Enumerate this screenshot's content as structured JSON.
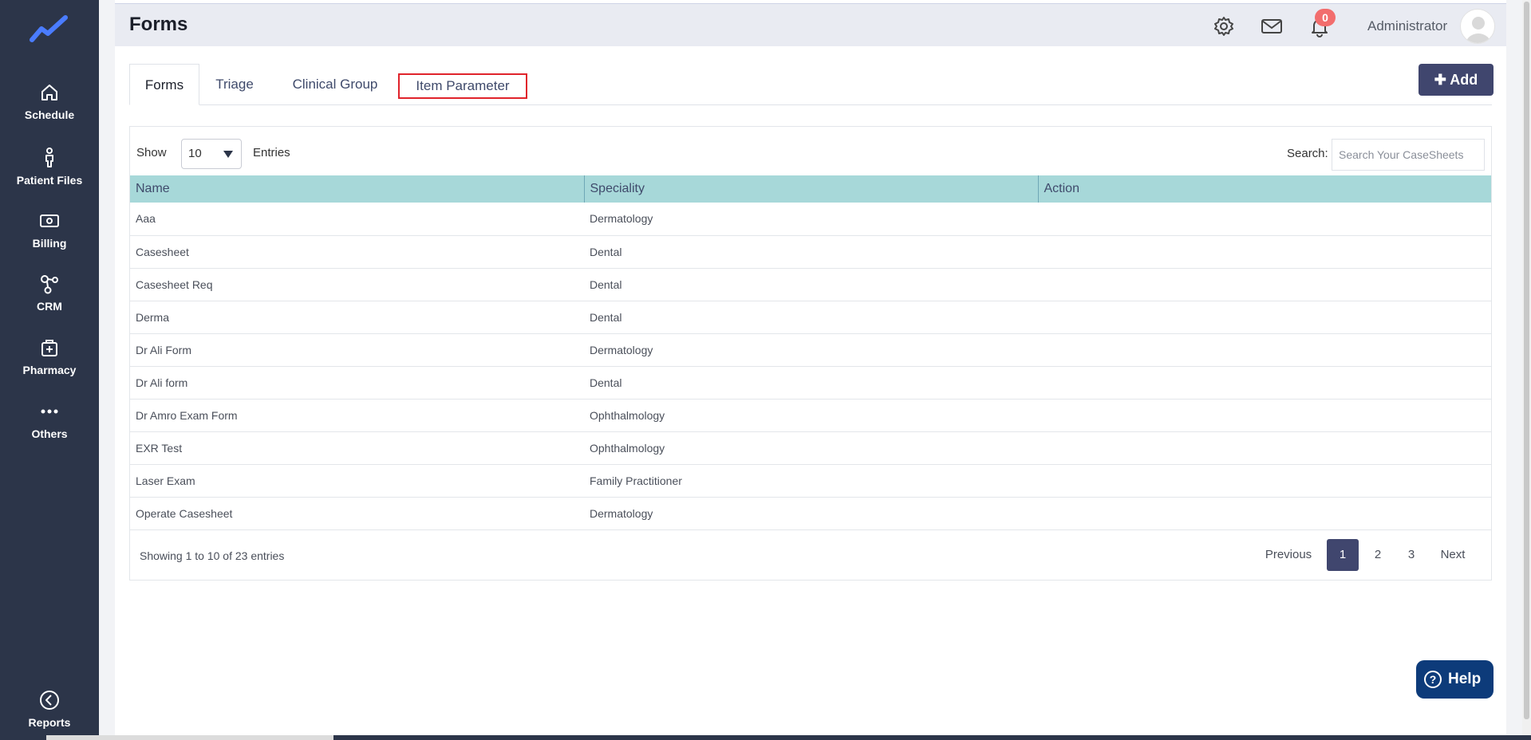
{
  "page": {
    "title": "Forms"
  },
  "sidebar": {
    "items": [
      {
        "label": "Schedule",
        "icon": "home-icon"
      },
      {
        "label": "Patient Files",
        "icon": "person-icon"
      },
      {
        "label": "Billing",
        "icon": "money-icon"
      },
      {
        "label": "CRM",
        "icon": "network-icon"
      },
      {
        "label": "Pharmacy",
        "icon": "medkit-icon"
      },
      {
        "label": "Others",
        "icon": "more-icon"
      }
    ],
    "footer": {
      "label": "Reports",
      "icon": "chevron-left-circle-icon"
    }
  },
  "header": {
    "notifications_count": "0",
    "user_name": "Administrator"
  },
  "tabs": [
    {
      "label": "Forms",
      "active": true
    },
    {
      "label": "Triage",
      "active": false
    },
    {
      "label": "Clinical Group",
      "active": false
    },
    {
      "label": "Item Parameter",
      "active": false
    }
  ],
  "toolbar": {
    "add_label": "Add"
  },
  "table_controls": {
    "show_label": "Show",
    "entries_value": "10",
    "entries_label": "Entries",
    "search_label": "Search:",
    "search_placeholder": "Search Your CaseSheets"
  },
  "table": {
    "headers": [
      "Name",
      "Speciality",
      "Action"
    ],
    "rows": [
      {
        "name": "Aaa",
        "speciality": "Dermatology"
      },
      {
        "name": "Casesheet",
        "speciality": "Dental"
      },
      {
        "name": "Casesheet Req",
        "speciality": "Dental"
      },
      {
        "name": "Derma",
        "speciality": "Dental"
      },
      {
        "name": "Dr Ali Form",
        "speciality": "Dermatology"
      },
      {
        "name": "Dr Ali form",
        "speciality": "Dental"
      },
      {
        "name": "Dr Amro Exam Form",
        "speciality": "Ophthalmology"
      },
      {
        "name": "EXR Test",
        "speciality": "Ophthalmology"
      },
      {
        "name": "Laser Exam",
        "speciality": "Family Practitioner"
      },
      {
        "name": "Operate Casesheet",
        "speciality": "Dermatology"
      }
    ]
  },
  "pagination": {
    "info": "Showing 1 to 10 of 23 entries",
    "previous": "Previous",
    "pages": [
      "1",
      "2",
      "3"
    ],
    "current": "1",
    "next": "Next"
  },
  "help": {
    "label": "Help",
    "glyph": "?"
  },
  "colors": {
    "sidebar_bg": "#2c3549",
    "accent": "#40466e",
    "table_header": "#a7d8d9",
    "badge": "#f26d6d",
    "highlight_box": "#e0232b",
    "help_bg": "#0d3b7a"
  }
}
